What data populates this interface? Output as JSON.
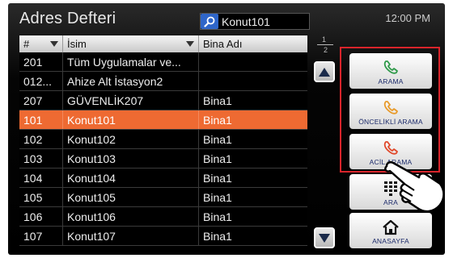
{
  "header": {
    "title": "Adres Defteri",
    "search_value": "Konut101",
    "clock": "12:00 PM"
  },
  "table": {
    "columns": [
      "#",
      "İsim",
      "Bina Adı"
    ],
    "rows": [
      {
        "no": "201",
        "name": "Tüm Uygulamalar ve...",
        "building": ""
      },
      {
        "no": "012...",
        "name": "Ahize Alt İstasyon2",
        "building": ""
      },
      {
        "no": "207",
        "name": "GÜVENLİK207",
        "building": "Bina1"
      },
      {
        "no": "101",
        "name": "Konut101",
        "building": "Bina1",
        "selected": true
      },
      {
        "no": "102",
        "name": "Konut102",
        "building": "Bina1"
      },
      {
        "no": "103",
        "name": "Konut103",
        "building": "Bina1"
      },
      {
        "no": "104",
        "name": "Konut104",
        "building": "Bina1"
      },
      {
        "no": "105",
        "name": "Konut105",
        "building": "Bina1"
      },
      {
        "no": "106",
        "name": "Konut106",
        "building": "Bina1"
      },
      {
        "no": "107",
        "name": "Konut107",
        "building": "Bina1"
      }
    ],
    "selected_color": "#ee6a32"
  },
  "pager": {
    "current": "1",
    "total": "2"
  },
  "buttons": {
    "call": "ARAMA",
    "priority_call": "ÖNCELİKLİ ARAMA",
    "emergency_call": "ACİL ARAMA",
    "dial": "ARA",
    "home": "ANASAYFA"
  },
  "icons": {
    "call": "phone-green-icon",
    "priority_call": "phone-orange-icon",
    "emergency_call": "phone-red-icon",
    "dial": "keypad-icon",
    "home": "home-icon",
    "search": "magnifier-icon"
  },
  "colors": {
    "call_icon": "#2f9a4a",
    "priority_icon": "#e89a2a",
    "emergency_icon": "#e0482a",
    "highlight_frame": "#d9242b"
  }
}
